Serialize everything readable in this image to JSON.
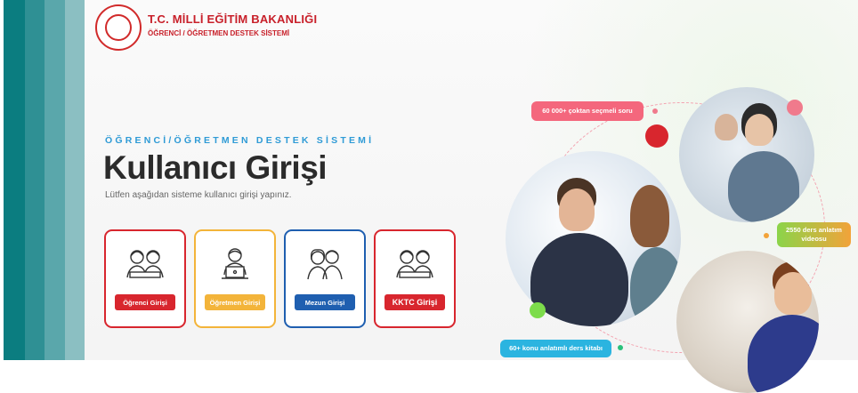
{
  "header": {
    "org_title": "T.C. MİLLİ EĞİTİM BAKANLIĞI",
    "org_subtitle": "ÖĞRENCİ / ÖĞRETMEN DESTEK SİSTEMİ"
  },
  "hero": {
    "kicker": "ÖĞRENCİ/ÖĞRETMEN DESTEK SİSTEMİ",
    "title": "Kullanıcı Girişi",
    "description": "Lütfen aşağıdan sisteme kullanıcı girişi yapınız."
  },
  "login_cards": [
    {
      "label": "Öğrenci Girişi",
      "icon": "students-icon"
    },
    {
      "label": "Öğretmen Girişi",
      "icon": "teacher-laptop-icon"
    },
    {
      "label": "Mezun Girişi",
      "icon": "graduates-icon"
    },
    {
      "label": "KKTC Girişi",
      "icon": "students-icon"
    }
  ],
  "stats": {
    "questions": "60 000+ çoktan seçmeli soru",
    "videos": "2550 ders anlatım videosu",
    "books": "60+ konu anlatımlı ders kitabı"
  },
  "colors": {
    "red": "#d8262e",
    "yellow": "#f3b43a",
    "blue": "#1f5fb0",
    "teal": "#0b7d80",
    "kicker_blue": "#2f9bd6"
  }
}
